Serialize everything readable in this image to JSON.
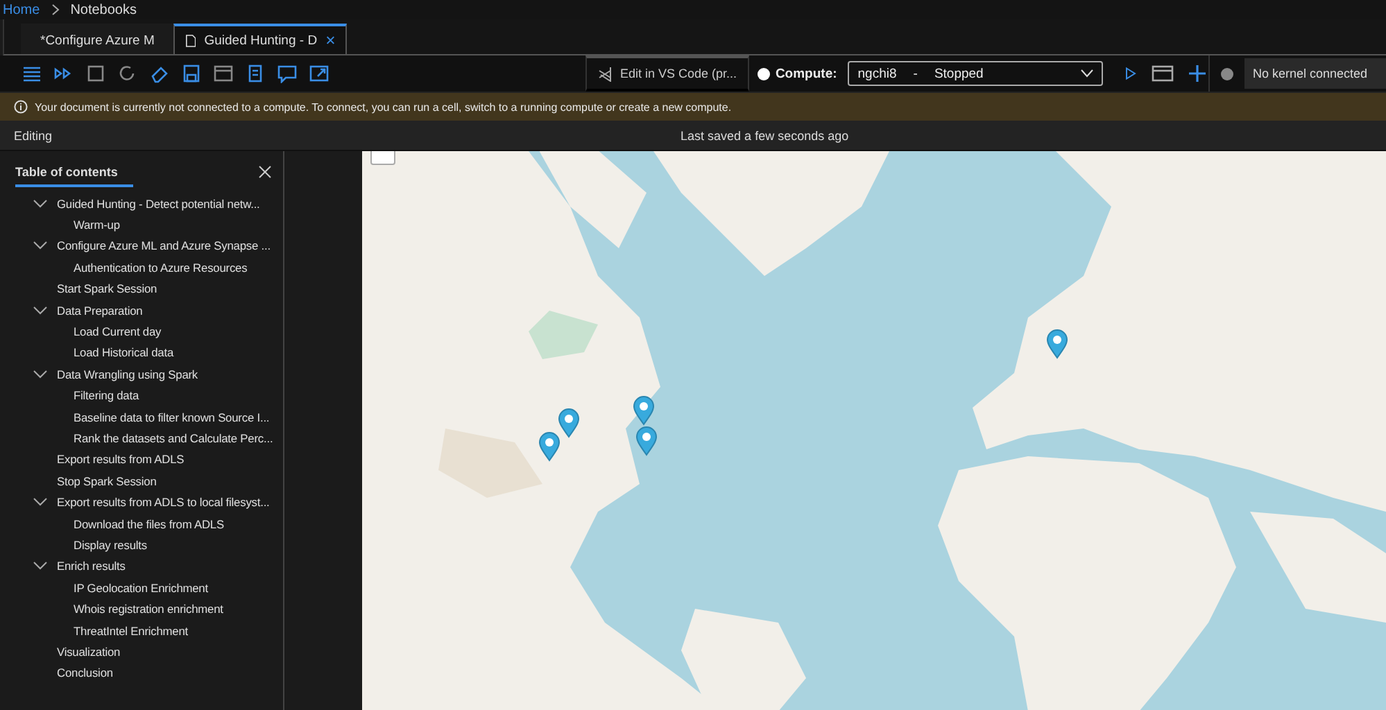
{
  "breadcrumb": [
    "Home",
    "Notebooks"
  ],
  "tabs": [
    {
      "label": "*Configure Azure M",
      "selected": false
    },
    {
      "label": "Guided Hunting - D",
      "selected": true
    }
  ],
  "toolbar": {
    "vscode_button": "Edit in VS Code (pr...",
    "compute_label": "Compute:",
    "compute": {
      "name": "ngchi8",
      "separator": "-",
      "status": "Stopped"
    },
    "kernel": "No kernel connected"
  },
  "banner": "Your document is currently not connected to a compute. To connect, you can run a cell, switch to a running compute or create a new compute.",
  "status_bar": {
    "mode": "Editing",
    "saved": "Last saved a few seconds ago"
  },
  "toc": {
    "title": "Table of contents",
    "items": [
      {
        "label": "Guided Hunting - Detect potential netw...",
        "expanded": true,
        "children": [
          {
            "label": "Warm-up"
          }
        ]
      },
      {
        "label": "Configure Azure ML and Azure Synapse ...",
        "expanded": true,
        "children": [
          {
            "label": "Authentication to Azure Resources"
          }
        ]
      },
      {
        "label": "Start Spark Session"
      },
      {
        "label": "Data Preparation",
        "expanded": true,
        "children": [
          {
            "label": "Load Current day"
          },
          {
            "label": "Load Historical data"
          }
        ]
      },
      {
        "label": "Data Wrangling using Spark",
        "expanded": true,
        "children": [
          {
            "label": "Filtering data"
          },
          {
            "label": "Baseline data to filter known Source I..."
          },
          {
            "label": "Rank the datasets and Calculate Perc..."
          }
        ]
      },
      {
        "label": "Export results from ADLS"
      },
      {
        "label": "Stop Spark Session"
      },
      {
        "label": "Export results from ADLS to local filesyst...",
        "expanded": true,
        "children": [
          {
            "label": "Download the files from ADLS"
          },
          {
            "label": "Display results"
          }
        ]
      },
      {
        "label": "Enrich results",
        "expanded": true,
        "children": [
          {
            "label": "IP Geolocation Enrichment"
          },
          {
            "label": "Whois registration enrichment"
          },
          {
            "label": "ThreatIntel Enrichment"
          }
        ]
      },
      {
        "label": "Visualization"
      },
      {
        "label": "Conclusion"
      }
    ]
  },
  "map": {
    "kind": "picture"
  }
}
